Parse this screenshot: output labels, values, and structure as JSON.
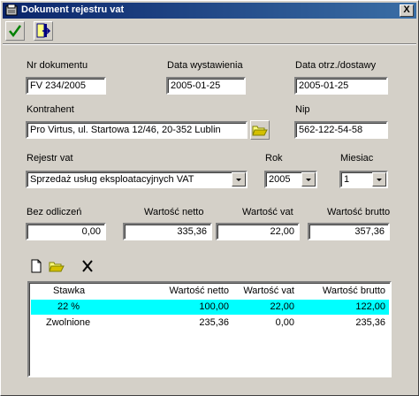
{
  "window": {
    "title": "Dokument rejestru vat",
    "close_symbol": "X"
  },
  "toolbar": {
    "accept_icon": "checkmark-icon",
    "exit_icon": "exit-door-icon"
  },
  "form": {
    "nr_dokumentu": {
      "label": "Nr dokumentu",
      "value": "FV 234/2005"
    },
    "data_wystawienia": {
      "label": "Data wystawienia",
      "value": "2005-01-25"
    },
    "data_otrz": {
      "label": "Data otrz./dostawy",
      "value": "2005-01-25"
    },
    "kontrahent": {
      "label": "Kontrahent",
      "value": "Pro Virtus, ul. Startowa 12/46, 20-352 Lublin"
    },
    "nip": {
      "label": "Nip",
      "value": "562-122-54-58"
    },
    "rejestr": {
      "label": "Rejestr vat",
      "value": "Sprzedaż usług eksploatacyjnych VAT"
    },
    "rok": {
      "label": "Rok",
      "value": "2005"
    },
    "miesiac": {
      "label": "Miesiac",
      "value": "1"
    },
    "bez_odliczen": {
      "label": "Bez odliczeń",
      "value": "0,00"
    },
    "wartosc_netto": {
      "label": "Wartość netto",
      "value": "335,36"
    },
    "wartosc_vat": {
      "label": "Wartość vat",
      "value": "22,00"
    },
    "wartosc_brutto": {
      "label": "Wartość brutto",
      "value": "357,36"
    }
  },
  "grid": {
    "columns": [
      "Stawka",
      "Wartość netto",
      "Wartość vat",
      "Wartość brutto"
    ],
    "rows": [
      {
        "stawka": "22 %",
        "netto": "100,00",
        "vat": "22,00",
        "brutto": "122,00",
        "selected": true
      },
      {
        "stawka": "Zwolnione",
        "netto": "235,36",
        "vat": "0,00",
        "brutto": "235,36",
        "selected": false
      }
    ],
    "highlight_color": "#00ffff"
  }
}
